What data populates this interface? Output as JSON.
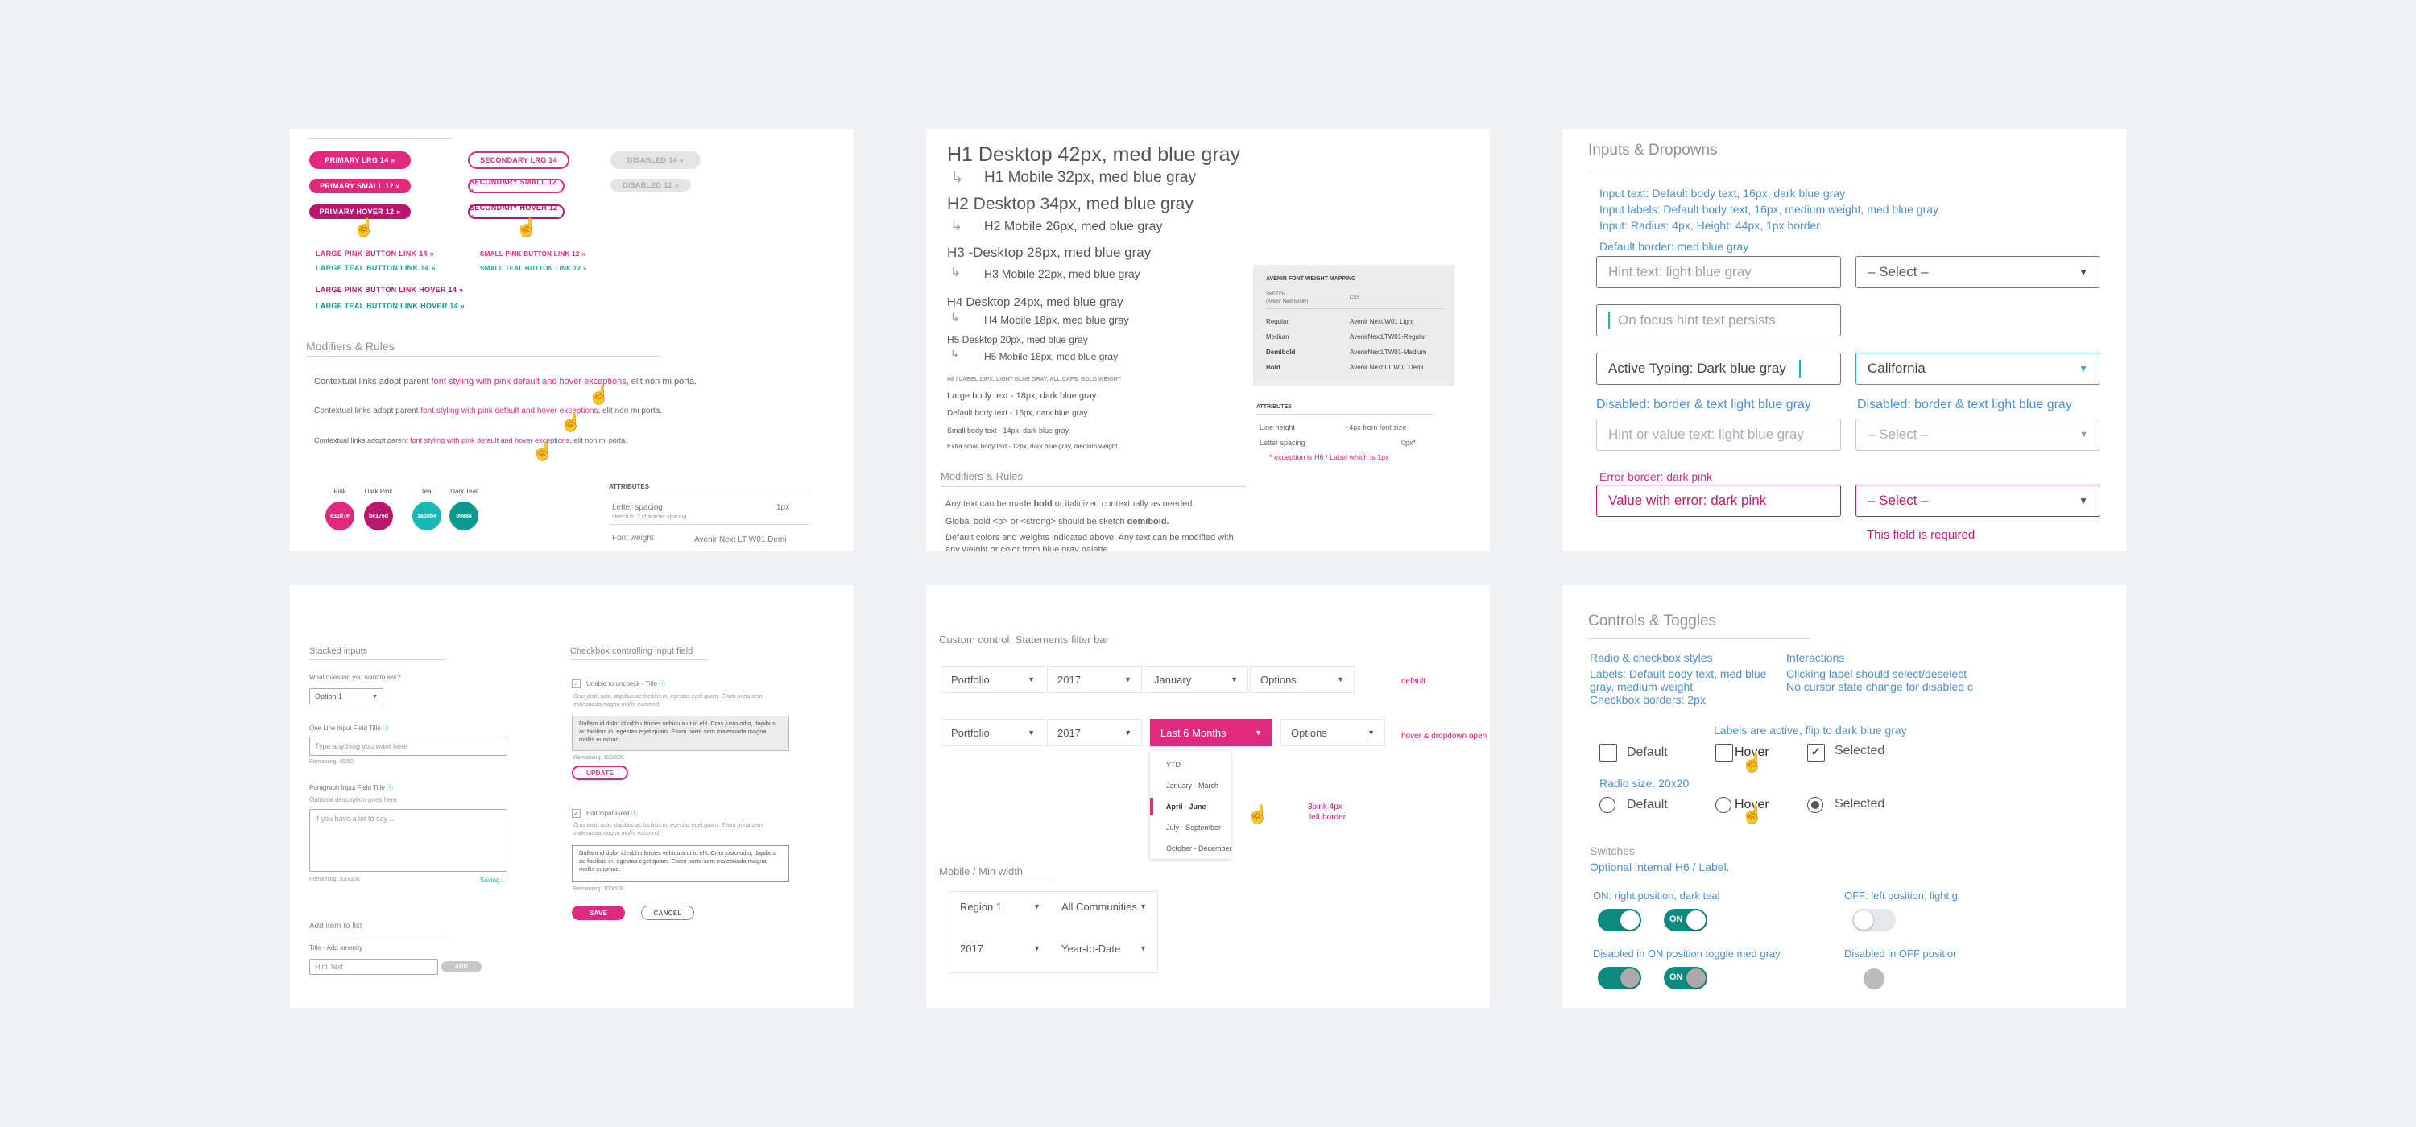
{
  "buttons": {
    "primary_lrg": "PRIMARY LRG 14 »",
    "primary_small": "PRIMARY SMALL 12 »",
    "primary_hover": "PRIMARY HOVER 12 »",
    "secondary_lrg": "SECONDARY LRG 14",
    "secondary_small": "SECONDARY SMALL 12 »",
    "secondary_hover": "SECONDARY HOVER 12 »",
    "disabled_14": "DISABLED 14 »",
    "disabled_12": "DISABLED 12 »",
    "links": [
      "LARGE PINK BUTTON LINK 14 »",
      "SMALL PINK BUTTON LINK 12 »",
      "LARGE TEAL BUTTON LINK 14 »",
      "SMALL TEAL BUTTON LINK 12 »",
      "LARGE PINK BUTTON LINK HOVER 14 »",
      "LARGE TEAL BUTTON LINK HOVER 14 »"
    ],
    "modifiers_title": "Modifiers & Rules",
    "ctx_pre": "Contextual links adopt parent ",
    "ctx_link": "font styling with pink default and hover exceptions,",
    "ctx_post": " elit non mi porta.",
    "swatches": [
      {
        "name": "Pink",
        "hex": "e32d7e",
        "color": "#e0287d"
      },
      {
        "name": "Dark Pink",
        "hex": "be176d",
        "color": "#b8176d"
      },
      {
        "name": "Teal",
        "hex": "1ab8b4",
        "color": "#1ab8b4"
      },
      {
        "name": "Dark Teal",
        "hex": "0088a",
        "color": "#0a9a8f"
      }
    ],
    "attributes_title": "ATTRIBUTES",
    "letter_spacing_label": "Letter spacing",
    "letter_spacing_note": "sketch is .7 character spacing",
    "letter_spacing_value": "1px",
    "font_weight_label": "Font weight",
    "font_weight_value": "Avenir Next LT W01 Demi"
  },
  "typography": {
    "h1d": "H1 Desktop 42px, med blue gray",
    "h1m": "H1 Mobile 32px, med blue gray",
    "h2d": "H2 Desktop 34px, med blue gray",
    "h2m": "H2 Mobile 26px, med blue gray",
    "h3d": "H3 -Desktop 28px, med blue gray",
    "h3m": "H3 Mobile 22px, med blue gray",
    "h4d": "H4 Desktop 24px, med blue gray",
    "h4m": "H4 Mobile 18px, med blue gray",
    "h5d": "H5 Desktop 20px, med blue gray",
    "h5m": "H5 Mobile 18px, med blue gray",
    "h6": "H6 / LABEL  13PX, LIGHT BLUE GRAY, ALL CAPS, BOLD WEIGHT",
    "body_large": "Large body text - 18px, dark blue gray",
    "body_default": "Default body text - 16px, dark blue gray",
    "body_small": "Small body text - 14px, dark blue gray",
    "body_xsmall": "Extra small body text - 12px, dark blue gray, medium weight",
    "mapping_title": "AVENIR FONT WEIGHT MAPPING",
    "mapping_sketch": "SKETCH",
    "mapping_family": "(Avenir Next family)",
    "mapping_css": "CSS",
    "mapping_rows": [
      {
        "k": "Regular",
        "v": "Avenir Next W01 Light"
      },
      {
        "k": "Medium",
        "v": "AvenirNextLTW01-Regular"
      },
      {
        "k": "Demibold",
        "v": "AvenirNextLTW01-Medium"
      },
      {
        "k": "Bold",
        "v": "Avenir Next LT W01 Demi"
      }
    ],
    "attr_title": "ATTRIBUTES",
    "line_height": "Line height",
    "line_height_v": "+4px from font size",
    "letter_spacing": "Letter spacing",
    "letter_spacing_v": "0px*",
    "exception": "* exception is H6 / Label which is  1px",
    "modifiers_title": "Modifiers & Rules",
    "mod1_pre": "Any text can be made ",
    "mod1_bold": "bold",
    "mod1_post": " or italicized contextually as needed.",
    "mod2_pre": "Global bold <b> or <strong> should be sketch ",
    "mod2_bold": "demibold.",
    "mod3": "Default colors and weights indicated above. Any text can be modified with",
    "mod4": "any weight or color from blue gray palette."
  },
  "inputs": {
    "title": "Inputs & Dropowns",
    "spec1": "Input text: Default body text, 16px, dark blue gray",
    "spec2": "Input labels: Default body text, 16px, medium weight, med blue gray",
    "spec3": "Input: Radius: 4px, Height: 44px, 1px border",
    "default_border": "Default border: med blue gray",
    "hint": "Hint text:  light blue gray",
    "select": "– Select –",
    "focus_hint": "On focus hint text persists",
    "active": "Active Typing: Dark blue gray",
    "california": "California",
    "disabled_label": "Disabled: border & text light blue gray",
    "disabled_label2": "Disabled: border & text light blue gray",
    "hint_value": "Hint or value text:  light blue gray",
    "error_border": "Error border: dark pink",
    "error_value": "Value with error: dark pink",
    "required": "This field is required"
  },
  "forms": {
    "stacked": "Stacked inputs",
    "question": "What question you want to ask?",
    "option1": "Option 1",
    "one_line": "One Line Input Field Title",
    "type_anything": "Type anything you want here",
    "remaining1": "Remaining: 45/50",
    "paragraph": "Paragraph Input Field Title",
    "optional_desc": "Optional description goes here",
    "if_you_have": "If you have a lot to say ...",
    "remaining2": "Remaining: 330/300",
    "saving": "Saving...",
    "add_item": "Add item to list",
    "title_add": "Title - Add amenity",
    "hint_text": "Hint Text",
    "add": "ADD",
    "checkbox_ctrl": "Checkbox controlling input field",
    "unable": "Unable to uncheck - Title",
    "lorem1": "Cras justo odio, dapibus ac facilisis in, egestas eget quam. Etiam porta sem malesuada magna mollis euismod.",
    "nullam": "Nullam id dolor id nibh ultricies vehicula ut id elit. Cras justo odio, dapibus ac facilisis in, egestas eget quam. Etiam porta sem malesuada magna mollis euismod.",
    "remaining3": "Remaining: 100/500",
    "update": "UPDATE",
    "edit": "Edit Input Field",
    "lorem2": "Cras justo odio, dapibus ac facilisis in, egestas eget quam. Etiam porta sem malesuada magna mollis euismod.",
    "remaining4": "Remaining: 100/500",
    "save": "SAVE",
    "cancel": "CANCEL"
  },
  "filters": {
    "title": "Custom control: Statements filter bar",
    "portfolio": "Portfolio",
    "year": "2017",
    "january": "January",
    "options": "Options",
    "default": "default",
    "last6": "Last 6 Months",
    "hover_open": "hover & dropdown open",
    "menu": [
      "YTD",
      "January - March",
      "April - June",
      "July - September",
      "October - December"
    ],
    "pink_note1": "3pink 4px",
    "pink_note2": "left border",
    "mobile_title": "Mobile / Min width",
    "region": "Region 1",
    "all_comm": "All Communities",
    "ytd": "Year-to-Date"
  },
  "controls": {
    "title": "Controls & Toggles",
    "radio_styles": "Radio & checkbox styles",
    "labels_spec1": "Labels: Default body text, med blue",
    "labels_spec2": "gray, medium weight",
    "borders": "Checkbox borders: 2px",
    "interactions": "Interactions",
    "inter1": "Clicking label should select/deselect",
    "inter2": "No cursor state change for disabled c",
    "labels_active": "Labels are active, flip to dark blue gray",
    "default": "Default",
    "hover": "Hover",
    "selected": "Selected",
    "radio_size": "Radio size: 20x20",
    "switches": "Switches",
    "optional_h6": "Optional internal H6 / Label.",
    "on_right": "ON: right position, dark teal",
    "off_left": "OFF: left position, light g",
    "on": "ON",
    "disabled_on": "Disabled in ON position toggle med gray",
    "disabled_off": "Disabled in OFF positior"
  }
}
